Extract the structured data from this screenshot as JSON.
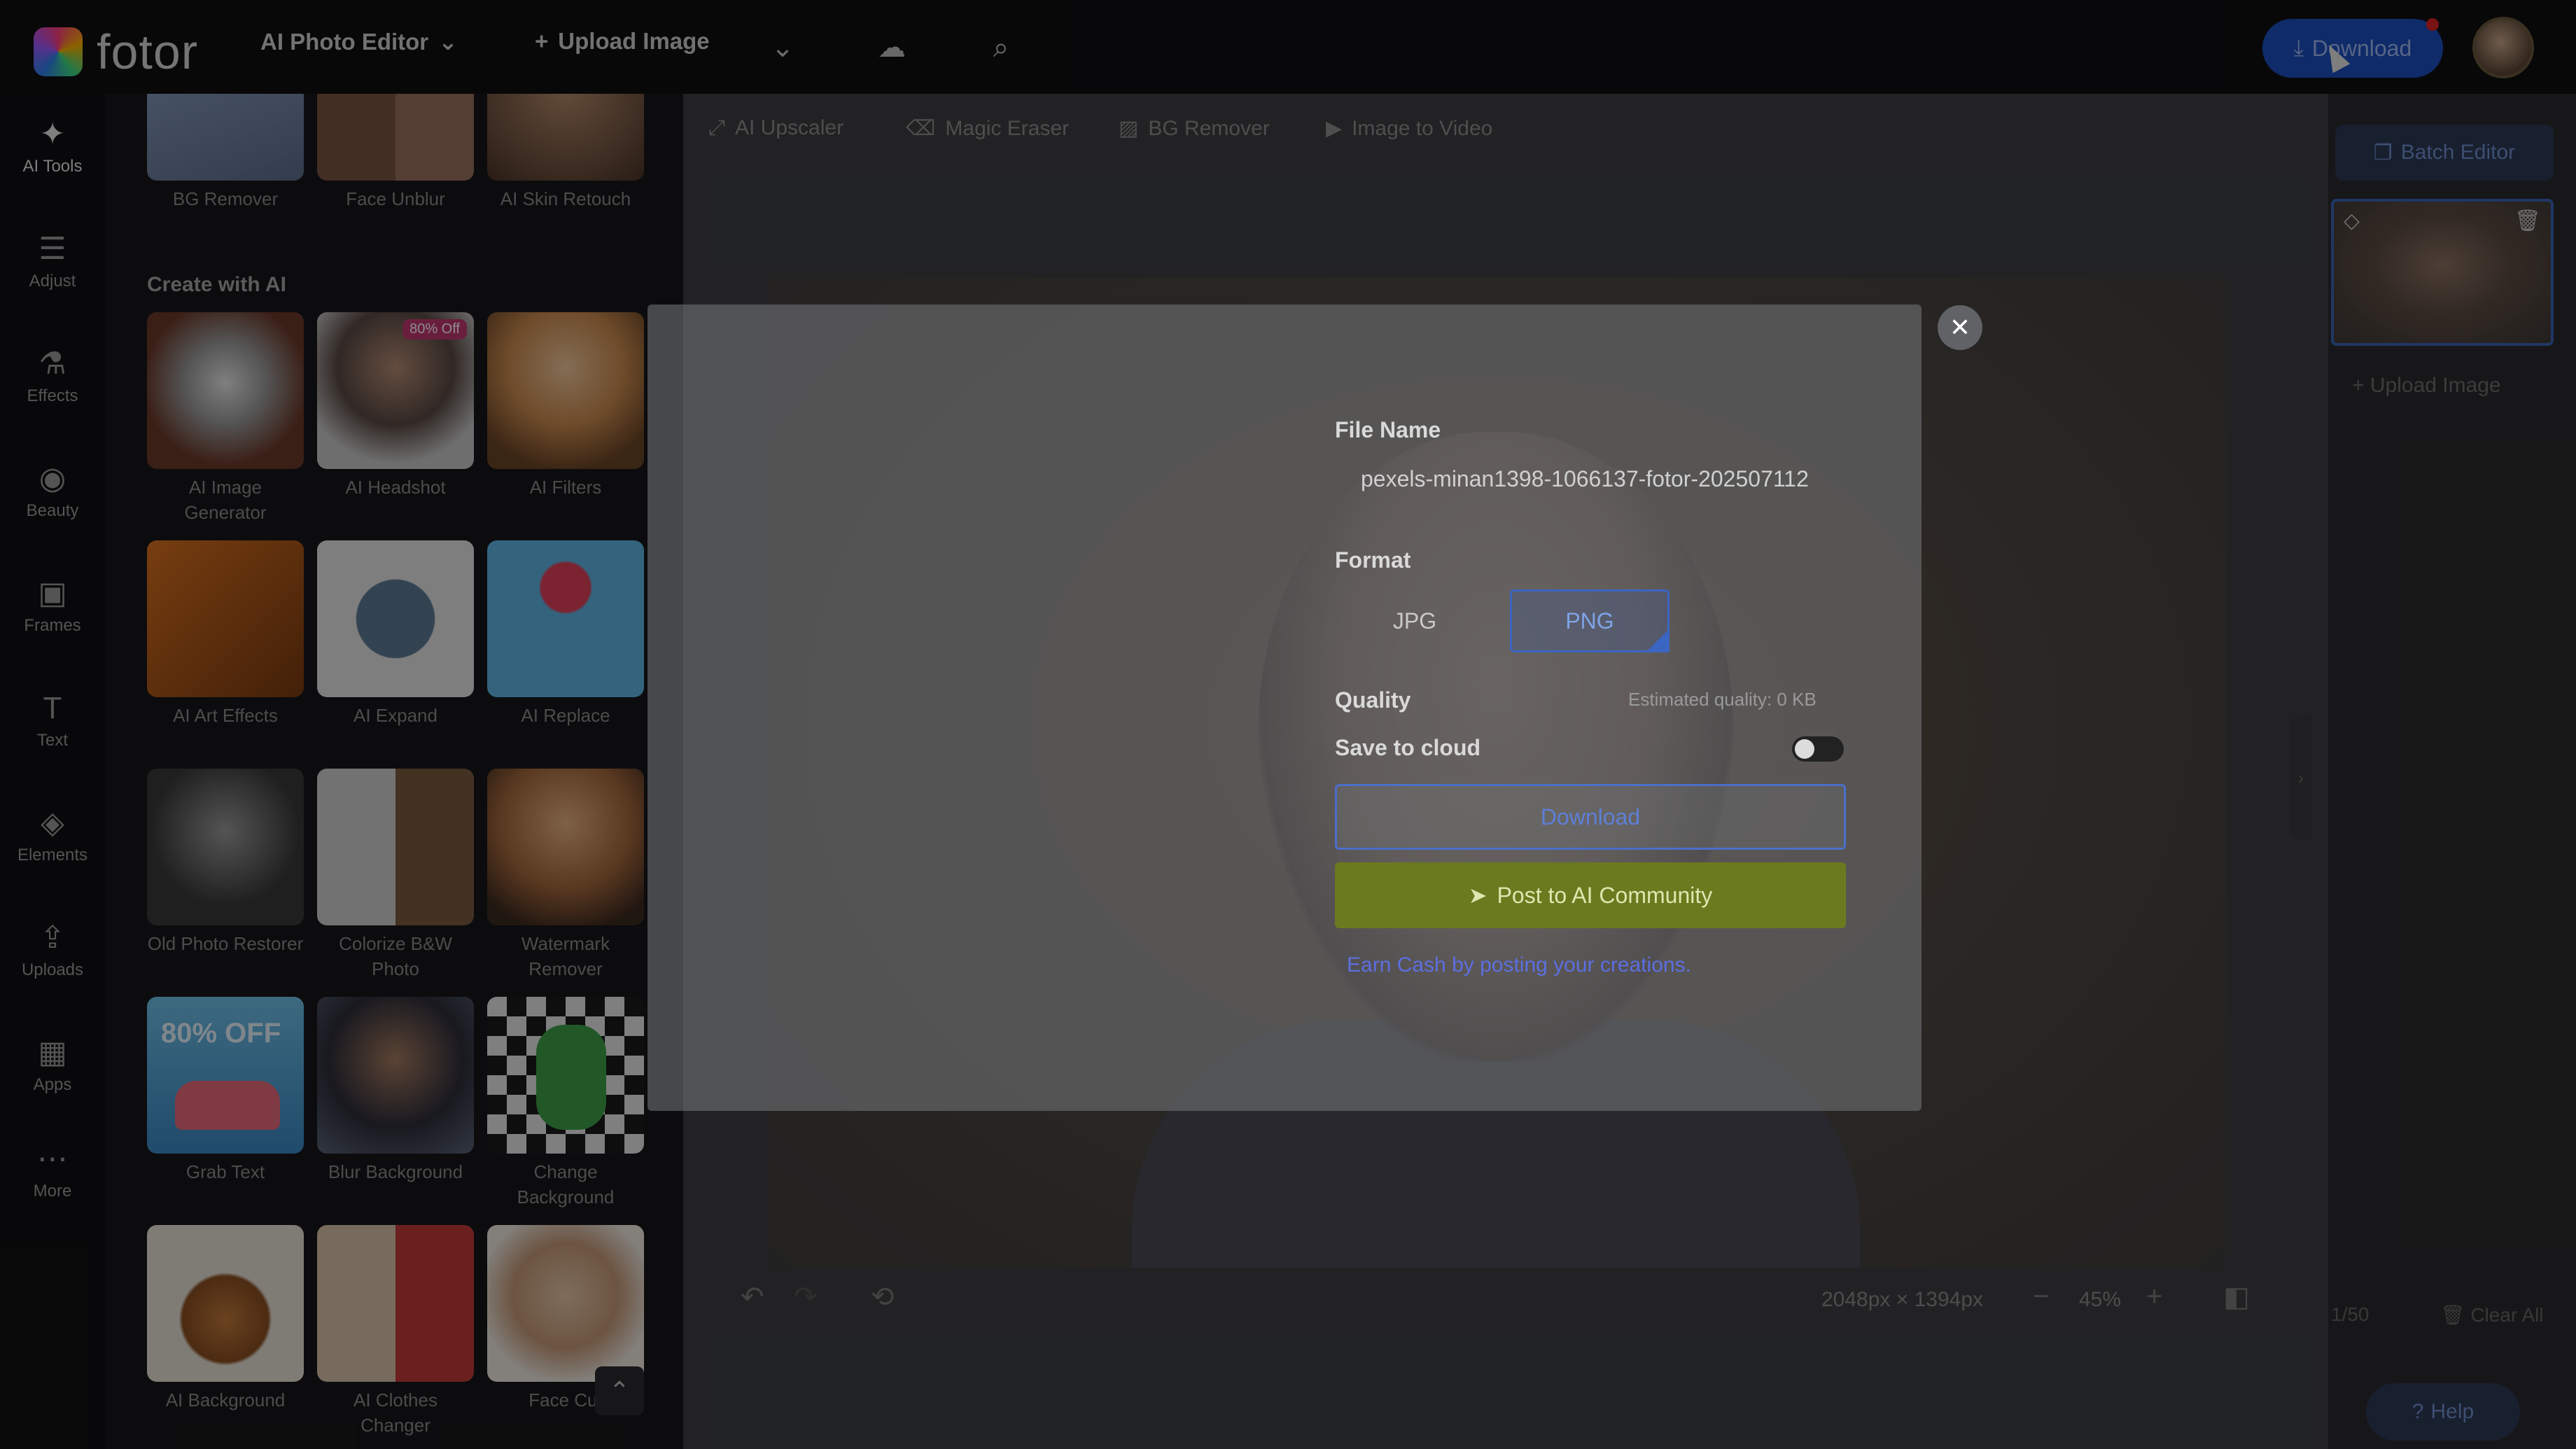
{
  "topbar": {
    "logo_text": "fotor",
    "menu_label": "AI Photo Editor",
    "upload_label": "Upload Image",
    "download_label": "Download"
  },
  "rail": [
    {
      "label": "AI Tools",
      "icon": "magic-icon"
    },
    {
      "label": "Adjust",
      "icon": "sliders-icon"
    },
    {
      "label": "Effects",
      "icon": "flask-icon"
    },
    {
      "label": "Beauty",
      "icon": "eye-icon"
    },
    {
      "label": "Frames",
      "icon": "frame-icon"
    },
    {
      "label": "Text",
      "icon": "text-icon"
    },
    {
      "label": "Elements",
      "icon": "shapes-icon"
    },
    {
      "label": "Uploads",
      "icon": "cloud-upload-icon"
    },
    {
      "label": "Apps",
      "icon": "apps-icon"
    },
    {
      "label": "More",
      "icon": "more-icon"
    }
  ],
  "panel": {
    "top_tiles": [
      "BG Remover",
      "Face Unblur",
      "AI Skin Retouch"
    ],
    "section_title": "Create with AI",
    "tiles": [
      {
        "label": "AI Image Generator"
      },
      {
        "label": "AI Headshot",
        "badge": "80% Off"
      },
      {
        "label": "AI Filters"
      },
      {
        "label": "AI Art Effects"
      },
      {
        "label": "AI Expand"
      },
      {
        "label": "AI Replace"
      },
      {
        "label": "Old Photo Restorer"
      },
      {
        "label": "Colorize B&W Photo"
      },
      {
        "label": "Watermark Remover"
      },
      {
        "label": "Grab Text",
        "overlay": "80% OFF"
      },
      {
        "label": "Blur Background"
      },
      {
        "label": "Change Background"
      },
      {
        "label": "AI Background"
      },
      {
        "label": "AI Clothes Changer"
      },
      {
        "label": "Face Cut"
      }
    ]
  },
  "toolbar": {
    "items": [
      "AI Upscaler",
      "Magic Eraser",
      "BG Remover",
      "Image to Video"
    ]
  },
  "bottom": {
    "dimensions": "2048px × 1394px",
    "zoom": "45%"
  },
  "right_panel": {
    "batch_label": "Batch Editor",
    "upload_label": "Upload Image",
    "count": "1/50",
    "clear_label": "Clear All",
    "help_label": "Help"
  },
  "modal": {
    "file_name_label": "File Name",
    "file_name_value": "pexels-minan1398-1066137-fotor-202507112",
    "format_label": "Format",
    "formats": [
      "JPG",
      "PNG"
    ],
    "selected_format": "PNG",
    "quality_label": "Quality",
    "estimated_quality": "Estimated quality: 0 KB",
    "save_cloud_label": "Save to cloud",
    "save_cloud_on": false,
    "download_label": "Download",
    "post_label": "Post to AI Community",
    "earn_text": "Earn Cash by posting your creations."
  },
  "colors": {
    "accent": "#3b65c2",
    "post_button": "#6b7a1e",
    "earn_link": "#5c6fe0"
  }
}
